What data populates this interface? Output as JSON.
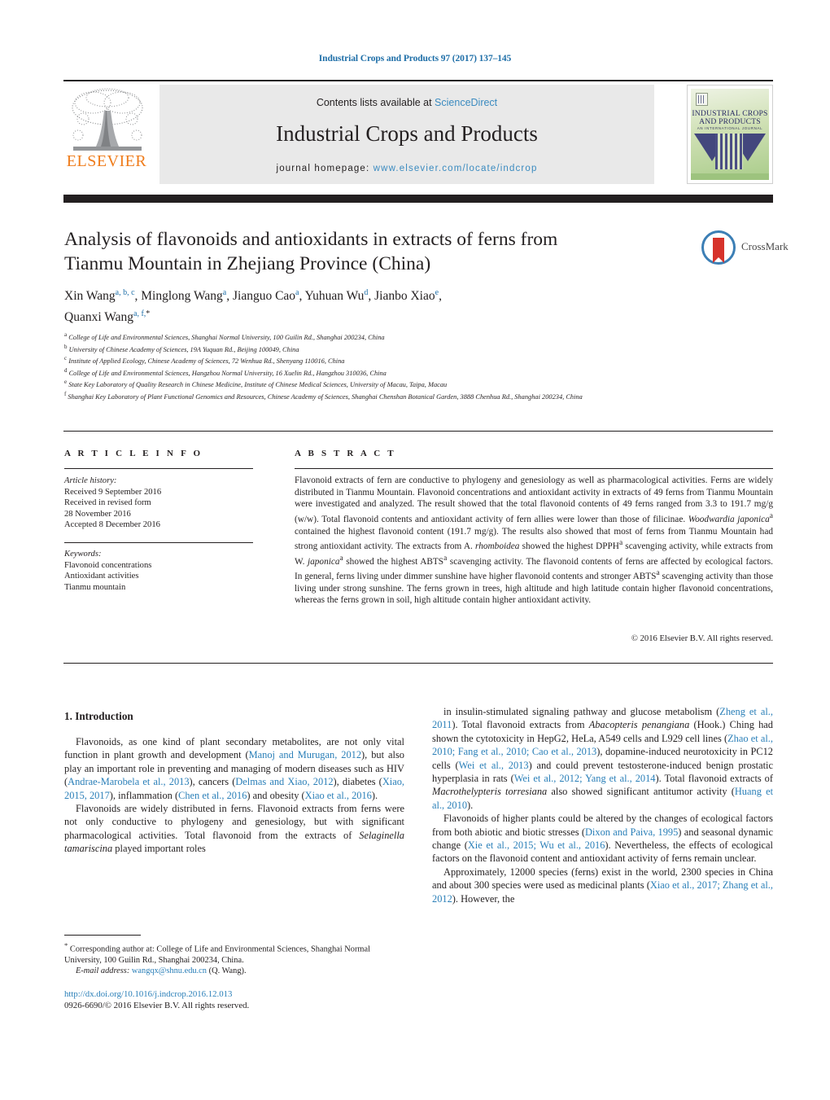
{
  "running_head": "Industrial Crops and Products 97 (2017) 137–145",
  "masthead": {
    "contents_prefix": "Contents lists available at ",
    "contents_link": "ScienceDirect",
    "journal_title": "Industrial Crops and Products",
    "homepage_label": "journal homepage: ",
    "homepage_url": "www.elsevier.com/locate/indcrop",
    "publisher_wordmark": "ELSEVIER",
    "publisher_color": "#ef7c1b",
    "link_color": "#3b8bc0",
    "cover": {
      "line1": "INDUSTRIAL CROPS",
      "line2": "AND PRODUCTS",
      "sub": "AN INTERNATIONAL JOURNAL"
    }
  },
  "article": {
    "title": "Analysis of flavonoids and antioxidants in extracts of ferns from Tianmu Mountain in Zhejiang Province (China)",
    "crossmark_label": "CrossMark",
    "authors_line1_a": "Xin Wang",
    "authors_line1_a_sup": "a, b, c",
    "authors_line1_b": ", Minglong Wang",
    "authors_line1_b_sup": "a",
    "authors_line1_c": ", Jianguo Cao",
    "authors_line1_c_sup": "a",
    "authors_line1_d": ", Yuhuan Wu",
    "authors_line1_d_sup": "d",
    "authors_line1_e": ", Jianbo Xiao",
    "authors_line1_e_sup": "e",
    "authors_line1_tail": ",",
    "authors_line2": "Quanxi Wang",
    "authors_line2_sup": "a, f,",
    "authors_line2_star": "*",
    "affiliations": [
      {
        "label": "a",
        "text": "College of Life and Environmental Sciences, Shanghai Normal University, 100 Guilin Rd., Shanghai 200234, China"
      },
      {
        "label": "b",
        "text": "University of Chinese Academy of Sciences, 19A Yuquan Rd., Beijing 100049, China"
      },
      {
        "label": "c",
        "text": "Institute of Applied Ecology, Chinese Academy of Sciences, 72 Wenhua Rd., Shenyang 110016, China"
      },
      {
        "label": "d",
        "text": "College of Life and Environmental Sciences, Hangzhou Normal University, 16 Xuelin Rd., Hangzhou 310036, China"
      },
      {
        "label": "e",
        "text": "State Key Laboratory of Quality Research in Chinese Medicine, Institute of Chinese Medical Sciences, University of Macau, Taipa, Macau"
      },
      {
        "label": "f",
        "text": "Shanghai Key Laboratory of Plant Functional Genomics and Resources, Chinese Academy of Sciences, Shanghai Chenshan Botanical Garden, 3888 Chenhua Rd., Shanghai 200234, China"
      }
    ]
  },
  "article_info": {
    "heading": "A R T I C L E  I N F O",
    "history_label": "Article history:",
    "history": [
      "Received 9 September 2016",
      "Received in revised form",
      "28 November 2016",
      "Accepted 8 December 2016"
    ],
    "keywords_label": "Keywords:",
    "keywords": [
      "Flavonoid concentrations",
      "Antioxidant activities",
      "Tianmu mountain"
    ]
  },
  "abstract": {
    "heading": "A B S T R A C T",
    "paragraph_1": "Flavonoid extracts of fern are conductive to phylogeny and genesiology as well as pharmacological activities. Ferns are widely distributed in Tianmu Mountain. Flavonoid concentrations and antioxidant activity in extracts of 49 ferns from Tianmu Mountain were investigated and analyzed. The result showed that the total flavonoid contents of 49 ferns ranged from 3.3 to 191.7 mg/g (w/w). Total flavonoid contents and antioxidant activity of fern allies were lower than those of filicinae. ",
    "species_1": "Woodwardia japonica",
    "species_1_sup": "a",
    "paragraph_2": " contained the highest flavonoid content (191.7 mg/g). The results also showed that most of ferns from Tianmu Mountain had strong antioxidant activity. The extracts from A. ",
    "species_2": "rhomboidea",
    "paragraph_3": " showed the highest DPPH",
    "sup_a1": "a",
    "paragraph_4": " scavenging activity, while extracts from W. ",
    "species_3": "japonica",
    "species_3_sup": "a",
    "paragraph_5": " showed the highest ABTS",
    "sup_a2": "a",
    "paragraph_6": " scavenging activity. The flavonoid contents of ferns are affected by ecological factors. In general, ferns living under dimmer sunshine have higher flavonoid contents and stronger ABTS",
    "sup_a3": "a",
    "paragraph_7": " scavenging activity than those living under strong sunshine. The ferns grown in trees, high altitude and high latitude contain higher flavonoid concentrations, whereas the ferns grown in soil, high altitude contain higher antioxidant activity.",
    "copyright": "© 2016 Elsevier B.V. All rights reserved."
  },
  "body": {
    "section_number_title": "1.  Introduction",
    "left_column": [
      {
        "runs": [
          {
            "t": "Flavonoids, as one kind of plant secondary metabolites, are not only vital function in plant growth and development ("
          },
          {
            "t": "Manoj and Murugan, 2012",
            "k": "ref"
          },
          {
            "t": "), but also play an important role in preventing and managing of modern diseases such as HIV ("
          },
          {
            "t": "Andrae-Marobela et al., 2013",
            "k": "ref"
          },
          {
            "t": "), cancers ("
          },
          {
            "t": "Delmas and Xiao, 2012",
            "k": "ref"
          },
          {
            "t": "), diabetes ("
          },
          {
            "t": "Xiao, 2015, 2017",
            "k": "ref"
          },
          {
            "t": "), inflammation ("
          },
          {
            "t": "Chen et al., 2016",
            "k": "ref"
          },
          {
            "t": ") and obesity ("
          },
          {
            "t": "Xiao et al., 2016",
            "k": "ref"
          },
          {
            "t": ")."
          }
        ]
      },
      {
        "runs": [
          {
            "t": "Flavonoids are widely distributed in ferns. Flavonoid extracts from ferns were not only conductive to phylogeny and genesiology, but with significant pharmacological activities. Total flavonoid from the extracts of "
          },
          {
            "t": "Selaginella tamariscina",
            "k": "sp"
          },
          {
            "t": " played important roles"
          }
        ]
      }
    ],
    "right_column": [
      {
        "runs": [
          {
            "t": "in insulin-stimulated signaling pathway and glucose metabolism ("
          },
          {
            "t": "Zheng et al., 2011",
            "k": "ref"
          },
          {
            "t": "). Total flavonoid extracts from "
          },
          {
            "t": "Abacopteris penangiana",
            "k": "sp"
          },
          {
            "t": " (Hook.) Ching had shown the cytotoxicity in HepG2, HeLa, A549 cells and L929 cell lines ("
          },
          {
            "t": "Zhao et al., 2010; Fang et al., 2010; Cao et al., 2013",
            "k": "ref"
          },
          {
            "t": "), dopamine-induced neurotoxicity in PC12 cells ("
          },
          {
            "t": "Wei et al., 2013",
            "k": "ref"
          },
          {
            "t": ") and could prevent testosterone-induced benign prostatic hyperplasia in rats ("
          },
          {
            "t": "Wei et al., 2012; Yang et al., 2014",
            "k": "ref"
          },
          {
            "t": "). Total flavonoid extracts of "
          },
          {
            "t": "Macrothelypteris torresiana",
            "k": "sp"
          },
          {
            "t": " also showed significant antitumor activity ("
          },
          {
            "t": "Huang et al., 2010",
            "k": "ref"
          },
          {
            "t": ")."
          }
        ]
      },
      {
        "runs": [
          {
            "t": "Flavonoids of higher plants could be altered by the changes of ecological factors from both abiotic and biotic stresses ("
          },
          {
            "t": "Dixon and Paiva, 1995",
            "k": "ref"
          },
          {
            "t": ") and seasonal dynamic change ("
          },
          {
            "t": "Xie et al., 2015; Wu et al., 2016",
            "k": "ref"
          },
          {
            "t": "). Nevertheless, the effects of ecological factors on the flavonoid content and antioxidant activity of ferns remain unclear."
          }
        ]
      },
      {
        "runs": [
          {
            "t": "Approximately, 12000 species (ferns) exist in the world, 2300 species in China and about 300 species were used as medicinal plants ("
          },
          {
            "t": "Xiao et al., 2017; Zhang et al., 2012",
            "k": "ref"
          },
          {
            "t": "). However, the"
          }
        ]
      }
    ]
  },
  "footnote": {
    "star": "*",
    "corresponding": " Corresponding author at: College of Life and Environmental Sciences, Shanghai Normal University, 100 Guilin Rd., Shanghai 200234, China.",
    "email_label": "E-mail address:",
    "email": "wangqx@shnu.edu.cn",
    "email_owner": "(Q. Wang)."
  },
  "footer": {
    "doi": "http://dx.doi.org/10.1016/j.indcrop.2016.12.013",
    "issn_line": "0926-6690/© 2016 Elsevier B.V. All rights reserved."
  }
}
